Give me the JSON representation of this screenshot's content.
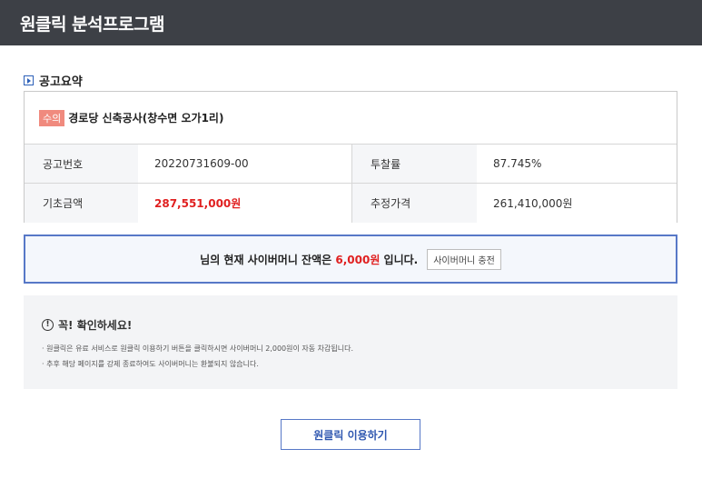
{
  "header": {
    "title": "원클릭 분석프로그램"
  },
  "section": {
    "title": "공고요약"
  },
  "summary": {
    "badge": "수의",
    "notice_name": "경로당 신축공사(창수면 오가1리)",
    "rows": [
      {
        "label1": "공고번호",
        "value1": "20220731609-00",
        "label2": "투찰률",
        "value2": "87.745%"
      },
      {
        "label1": "기초금액",
        "value1": "287,551,000원",
        "label2": "추정가격",
        "value2": "261,410,000원"
      }
    ]
  },
  "balance": {
    "prefix": "님의 현재 사이버머니 잔액은",
    "amount": "6,000원",
    "suffix": "입니다.",
    "charge_button": "사이버머니 충전"
  },
  "notice": {
    "title": "꼭! 확인하세요!",
    "icon_text": "!",
    "lines": [
      "· 원클릭은 유료 서비스로 원클릭 이용하기 버튼을 클릭하시면 사이버머니 2,000원이 자동 차감됩니다.",
      "· 추후 해당 페이지를 강제 종료하여도 사이버머니는 환불되지 않습니다."
    ]
  },
  "use_button": "원클릭 이용하기",
  "colors": {
    "header_bg": "#3d4046",
    "accent": "#5778c7",
    "highlight": "#e02020",
    "badge": "#f08a7e"
  }
}
